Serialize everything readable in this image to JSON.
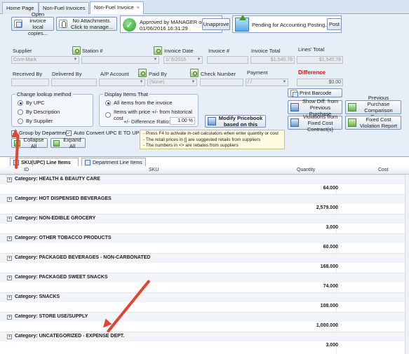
{
  "tabs": [
    {
      "label": "Home Page",
      "active": false
    },
    {
      "label": "Non-Fuel Invoices",
      "active": false
    },
    {
      "label": "Non-Fuel Invoice",
      "active": true,
      "close": "×"
    }
  ],
  "toolbar": {
    "open_invoice": "Open invoice local copies...",
    "no_attachments": "No Attachments. Click to manage...",
    "approved_line1": "Approved by MANAGER on",
    "approved_line2": "01/06/2016 16:31:29",
    "unapprove": "Unapprove",
    "pending": "Pending for Accounting Posting...",
    "post": "Post"
  },
  "fields": {
    "supplier_label": "Supplier",
    "supplier_value": "Core-Mark",
    "station_label": "Station #",
    "invoice_date_label": "Invoice Date",
    "invoice_date_value": "1/ 6/2016",
    "invoice_no_label": "Invoice #",
    "invoice_total_label": "Invoice Total",
    "invoice_total_value": "$1,540.78",
    "lines_total_label": "Lines' Total",
    "lines_total_value": "$1,540.78",
    "received_by_label": "Received By",
    "delivered_by_label": "Delivered By",
    "ap_account_label": "A/P Account",
    "paid_by_label": "Paid By",
    "paid_by_value": "(None)",
    "check_number_label": "Check Number",
    "payment_label": "Payment",
    "payment_value": "/   /",
    "difference_label": "Difference",
    "difference_value": "$0.00"
  },
  "lookup": {
    "title": "Change lookup method",
    "options": [
      "By UPC",
      "By Description",
      "By Supplier"
    ],
    "selected": 0
  },
  "display": {
    "title": "Display Items That",
    "options": [
      "All items from the invoice",
      "Items with price +/- from historical cost"
    ],
    "selected": 0,
    "ratio_label": "+/- Difference Ratio:",
    "ratio_value": "1.00 %"
  },
  "actions": {
    "modify_pricebook": "Modify Pricebook based on this",
    "print_barcode": "Print Barcode",
    "show_diff": "Show Diff. from Previous Purchase",
    "previous_purchase": "Previous Purchase Comparison Report",
    "violations": "Violations from Fixed Cost Contract(s)",
    "fixed_cost_report": "Fixed Cost Violation Report"
  },
  "options": {
    "group_by_department": "Group by Department",
    "group_by_checked": true,
    "auto_convert": "Auto Convert UPC E TO UPC A",
    "auto_convert_checked": true,
    "collapse_all": "Collapse All",
    "expand_all": "Expand All"
  },
  "notes": [
    "- Press F4 to activate in-cell calculators when enter quantity or cost",
    "- The retail prices in [] are suggested retails from suppliers",
    "- The numbers in <> are rebates from suppliers"
  ],
  "grid_tabs": [
    {
      "label": "SKU(UPC) Line Items",
      "active": true
    },
    {
      "label": "Department Line Items",
      "active": false
    }
  ],
  "columns": {
    "id": "ID",
    "sku": "SKU",
    "quantity": "Quantity",
    "cost": "Cost"
  },
  "categories": [
    {
      "name": "Category:  HEALTH & BEAUTY CARE",
      "quantity": "64.000",
      "cost": "$"
    },
    {
      "name": "Category:  HOT DISPENSED BEVERAGES",
      "quantity": "2,579.000",
      "cost": "$"
    },
    {
      "name": "Category:  NON-EDIBLE GROCERY",
      "quantity": "3.000",
      "cost": "$"
    },
    {
      "name": "Category:  OTHER TOBACCO PRODUCTS",
      "quantity": "60.000",
      "cost": "$"
    },
    {
      "name": "Category:  PACKAGED BEVERAGES - NON-CARBONATED",
      "quantity": "168.000",
      "cost": "$"
    },
    {
      "name": "Category:  PACKAGED SWEET SNACKS",
      "quantity": "74.000",
      "cost": "$"
    },
    {
      "name": "Category:  SNACKS",
      "quantity": "108.000",
      "cost": "$"
    },
    {
      "name": "Category:  STORE USE/SUPPLY",
      "quantity": "1,000.000",
      "cost": "$"
    },
    {
      "name": "Category:  UNCATEGORIZED - EXPENSE DEPT.",
      "quantity": "3.000",
      "cost": "$"
    }
  ],
  "colors": {
    "accent": "#e3452f",
    "difference": "#e01010",
    "approved": "#2c9a2c"
  }
}
